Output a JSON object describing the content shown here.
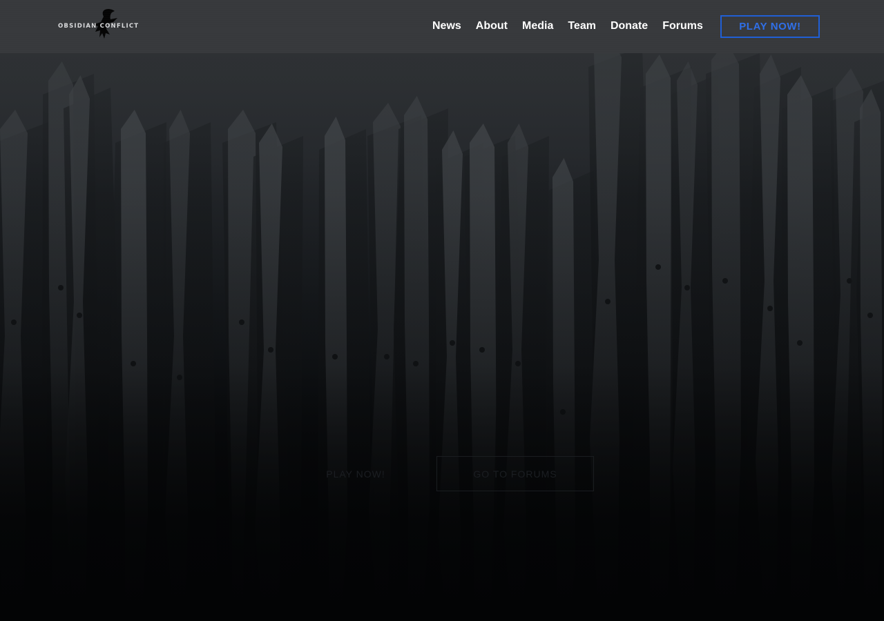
{
  "header": {
    "logo_text": "OBSIDIAN CONFLICT",
    "nav": [
      "News",
      "About",
      "Media",
      "Team",
      "Donate",
      "Forums"
    ],
    "cta_label": "PLAY NOW!"
  },
  "hero": {
    "play_label": "PLAY NOW!",
    "forums_label": "GO TO FORUMS"
  },
  "colors": {
    "header_bg": "#37393c",
    "accent": "#1f5fd6",
    "nav_text": "#ffffff"
  },
  "icons": {
    "logo": "bird-silhouette-icon"
  }
}
